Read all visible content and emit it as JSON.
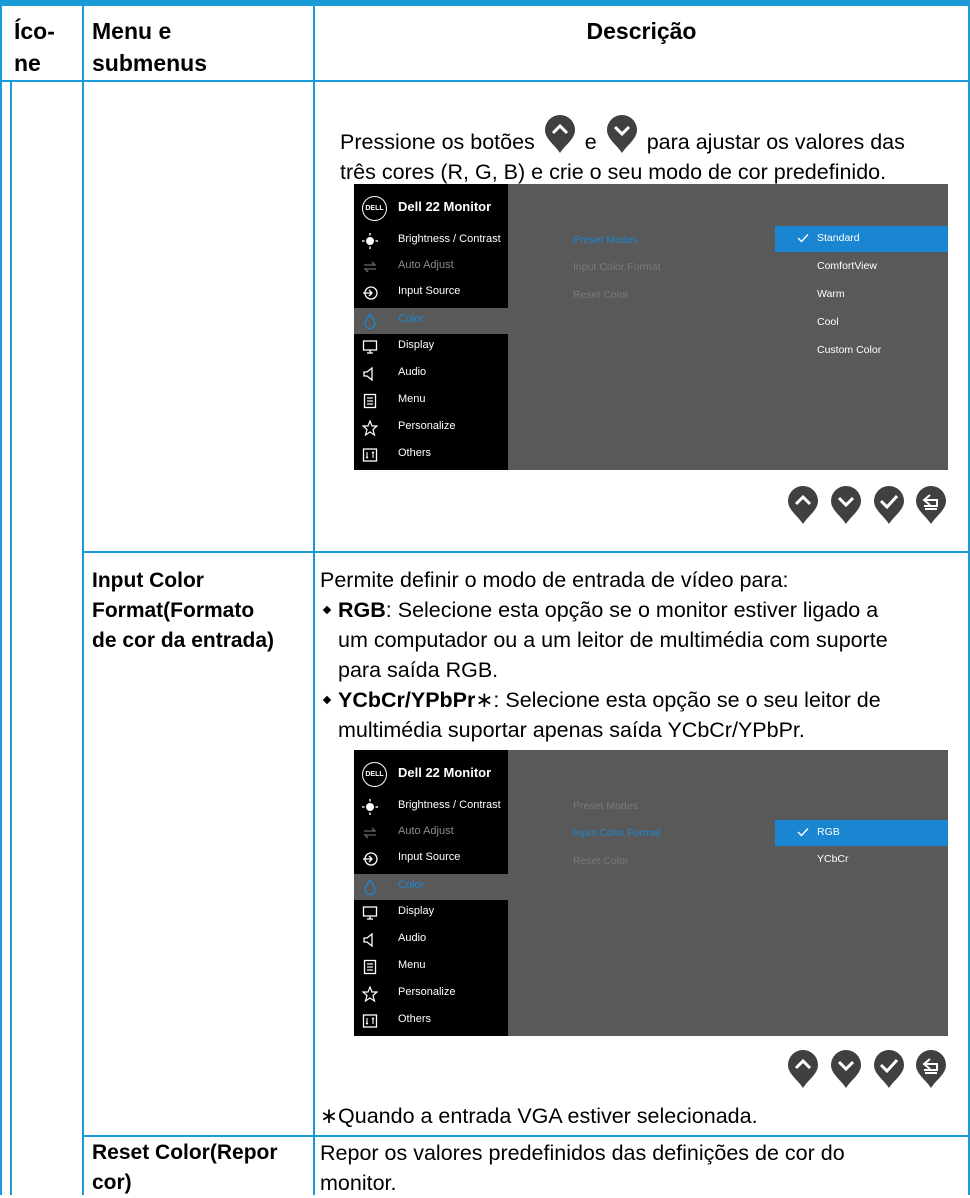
{
  "header": {
    "col_icon": "Íco-\nne",
    "col_menu": "Menu e\nsubmenus",
    "col_desc": "Descrição"
  },
  "section1": {
    "text_before": "Pressione os botões",
    "text_and": "e",
    "text_after": "para ajustar os valores das",
    "text_line2": "três cores (R, G, B) e crie o seu modo de cor predefinido."
  },
  "osd": {
    "logo": "DELL",
    "title": "Dell 22 Monitor",
    "menu": [
      {
        "label": "Brightness / Contrast",
        "icon": "brightness-icon"
      },
      {
        "label": "Auto Adjust",
        "icon": "auto-adjust-icon"
      },
      {
        "label": "Input Source",
        "icon": "input-source-icon"
      },
      {
        "label": "Color",
        "icon": "color-icon"
      },
      {
        "label": "Display",
        "icon": "display-icon"
      },
      {
        "label": "Audio",
        "icon": "audio-icon"
      },
      {
        "label": "Menu",
        "icon": "menu-icon"
      },
      {
        "label": "Personalize",
        "icon": "star-icon"
      },
      {
        "label": "Others",
        "icon": "others-icon"
      }
    ],
    "submenu": [
      "Preset Modes",
      "Input Color Format",
      "Reset Color"
    ],
    "osd1_options": [
      "Standard",
      "ComfortView",
      "Warm",
      "Cool",
      "Custom Color"
    ],
    "osd2_options": [
      "RGB",
      "YCbCr"
    ]
  },
  "row_input": {
    "menu": "Input Color\nFormat(Formato\nde cor da entrada)",
    "intro": "Permite definir o modo de entrada de vídeo para:",
    "b1_bold": "RGB",
    "b1_line1": ": Selecione esta opção se o monitor estiver ligado a",
    "b1_line2": "um computador ou a um leitor de multimédia com suporte",
    "b1_line3": "para saída RGB.",
    "b2_bold": "YCbCr/YPbPr",
    "b2_line1": "∗: Selecione esta opção se o seu leitor de",
    "b2_line2": "multimédia suportar apenas saída YCbCr/YPbPr.",
    "footnote": "∗Quando a entrada VGA estiver selecionada."
  },
  "row_reset": {
    "menu": "Reset Color(Repor\ncor)",
    "desc_line1": "Repor os valores predefinidos das definições de cor do",
    "desc_line2": "monitor."
  },
  "colors": {
    "accent": "#1a9ad6",
    "osd_highlight": "#1a86d1",
    "osd_panel": "#595959"
  }
}
